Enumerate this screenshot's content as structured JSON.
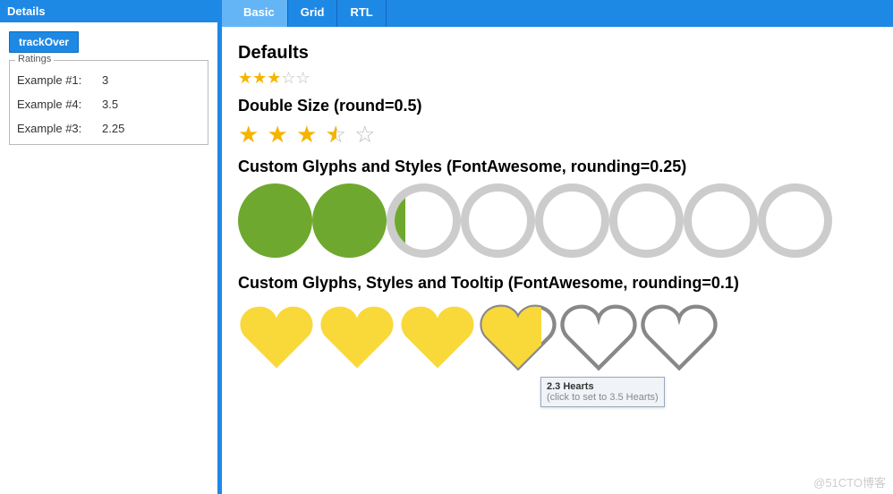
{
  "sidebar": {
    "header": "Details",
    "button": "trackOver",
    "fieldset_title": "Ratings",
    "rows": [
      {
        "label": "Example #1:",
        "value": "3"
      },
      {
        "label": "Example #4:",
        "value": "3.5"
      },
      {
        "label": "Example #3:",
        "value": "2.25"
      }
    ]
  },
  "tabs": {
    "items": [
      {
        "label": "Basic",
        "active": true
      },
      {
        "label": "Grid",
        "active": false
      },
      {
        "label": "RTL",
        "active": false
      }
    ]
  },
  "sections": {
    "defaults": {
      "title": "Defaults",
      "rating": 3,
      "max": 5
    },
    "double": {
      "title": "Double Size (round=0.5)",
      "rating": 3.5,
      "max": 5
    },
    "circles": {
      "title": "Custom Glyphs and Styles (FontAwesome, rounding=0.25)",
      "rating": 2.25,
      "max": 8,
      "fill_color": "#6fa82e",
      "empty_color": "#cccccc"
    },
    "hearts": {
      "title": "Custom Glyphs, Styles and Tooltip (FontAwesome, rounding=0.1)",
      "rating": 3.8,
      "max": 6,
      "fill_color": "#f9d83a",
      "empty_color": "#888888",
      "tooltip": {
        "title": "2.3 Hearts",
        "sub": "(click to set to 3.5 Hearts)"
      }
    }
  },
  "watermark": "@51CTO博客"
}
